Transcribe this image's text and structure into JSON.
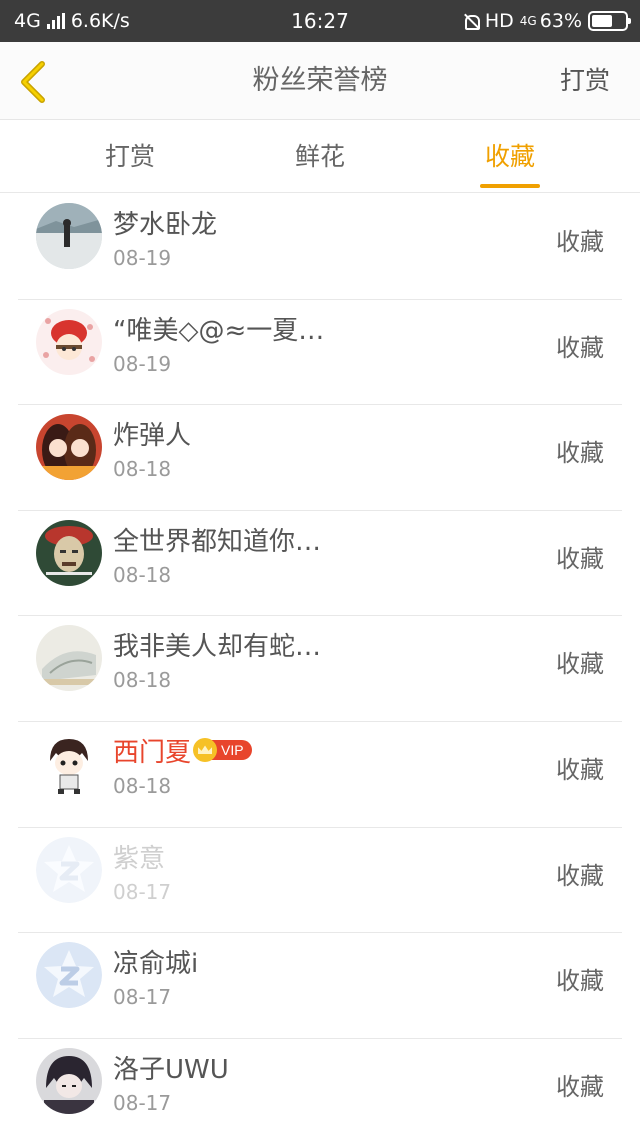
{
  "statusbar": {
    "network": "4G",
    "speed": "6.6K/s",
    "time": "16:27",
    "hd": "HD",
    "net2": "4G",
    "battery": "63%",
    "battery_level": 0.63
  },
  "nav": {
    "title": "粉丝荣誉榜",
    "right_action": "打赏"
  },
  "tabs": [
    {
      "label": "打赏",
      "active": false
    },
    {
      "label": "鲜花",
      "active": false
    },
    {
      "label": "收藏",
      "active": true
    }
  ],
  "colors": {
    "accent": "#f0a000",
    "vip_name": "#e8452c",
    "statusbar_bg": "#3c3c3c"
  },
  "rows": [
    {
      "name": "梦水卧龙",
      "date": "08-19",
      "action": "收藏",
      "avatar": "beach-photo"
    },
    {
      "name": "“唯美◇@≈一夏…",
      "date": "08-19",
      "action": "收藏",
      "avatar": "anime-girl-red-hat"
    },
    {
      "name": "炸弹人",
      "date": "08-18",
      "action": "收藏",
      "avatar": "anime-couple-red"
    },
    {
      "name": "全世界都知道你…",
      "date": "08-18",
      "action": "收藏",
      "avatar": "meme-face"
    },
    {
      "name": "我非美人却有蛇…",
      "date": "08-18",
      "action": "收藏",
      "avatar": "pale-illustration"
    },
    {
      "name": "西门夏",
      "date": "08-18",
      "action": "收藏",
      "avatar": "chibi-boy",
      "vip_label": "VIP"
    },
    {
      "name": "紫意",
      "date": "08-17",
      "action": "收藏",
      "avatar": "default-z-icon"
    },
    {
      "name": "凉俞城i",
      "date": "08-17",
      "action": "收藏",
      "avatar": "default-z-icon"
    },
    {
      "name": "洛子UWU",
      "date": "08-17",
      "action": "收藏",
      "avatar": "dark-hair-anime"
    }
  ]
}
